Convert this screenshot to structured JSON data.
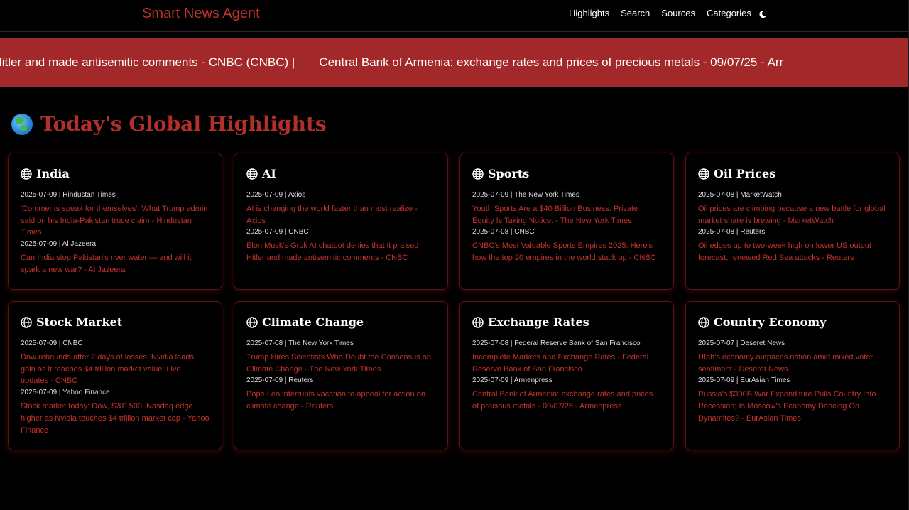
{
  "navbar": {
    "brand": "Smart News Agent",
    "links": [
      "Highlights",
      "Search",
      "Sources",
      "Categories"
    ],
    "theme_icon": "moon-icon"
  },
  "ticker": {
    "items": [
      "ot denies that it praised Hitler and made antisemitic comments - CNBC (CNBC) |",
      "Central Bank of Armenia: exchange rates and prices of precious metals - 09/07/25 - Arr"
    ]
  },
  "section": {
    "emoji": "globe-emoji-icon",
    "title": "Today's Global Highlights"
  },
  "colors": {
    "accent": "#b2302b",
    "ticker_bg": "#a3282a",
    "background": "#000000"
  },
  "cards": [
    {
      "title": "India",
      "articles": [
        {
          "meta": "2025-07-09 | Hindustan Times",
          "headline": "'Comments speak for themselves': What Trump admin said on his India-Pakistan truce claim - Hindustan Times"
        },
        {
          "meta": "2025-07-09 | Al Jazeera",
          "headline": "Can India stop Pakistan's river water — and will it spark a new war? - Al Jazeera"
        }
      ]
    },
    {
      "title": "AI",
      "articles": [
        {
          "meta": "2025-07-09 | Axios",
          "headline": "AI is changing the world faster than most realize - Axios"
        },
        {
          "meta": "2025-07-09 | CNBC",
          "headline": "Elon Musk's Grok AI chatbot denies that it praised Hitler and made antisemitic comments - CNBC"
        }
      ]
    },
    {
      "title": "Sports",
      "articles": [
        {
          "meta": "2025-07-09 | The New York Times",
          "headline": "Youth Sports Are a $40 Billion Business. Private Equity Is Taking Notice. - The New York Times"
        },
        {
          "meta": "2025-07-08 | CNBC",
          "headline": "CNBC's Most Valuable Sports Empires 2025: Here's how the top 20 empires in the world stack up - CNBC"
        }
      ]
    },
    {
      "title": "Oil Prices",
      "articles": [
        {
          "meta": "2025-07-08 | MarketWatch",
          "headline": "Oil prices are climbing because a new battle for global market share is brewing - MarketWatch"
        },
        {
          "meta": "2025-07-08 | Reuters",
          "headline": "Oil edges up to two-week high on lower US output forecast, renewed Red Sea attacks - Reuters"
        }
      ]
    },
    {
      "title": "Stock Market",
      "articles": [
        {
          "meta": "2025-07-09 | CNBC",
          "headline": "Dow rebounds after 2 days of losses, Nvidia leads gain as it reaches $4 trillion market value: Live updates - CNBC"
        },
        {
          "meta": "2025-07-09 | Yahoo Finance",
          "headline": "Stock market today: Dow, S&P 500, Nasdaq edge higher as Nvidia touches $4 trillion market cap - Yahoo Finance"
        }
      ]
    },
    {
      "title": "Climate Change",
      "articles": [
        {
          "meta": "2025-07-08 | The New York Times",
          "headline": "Trump Hires Scientists Who Doubt the Consensus on Climate Change - The New York Times"
        },
        {
          "meta": "2025-07-09 | Reuters",
          "headline": "Pope Leo interrupts vacation to appeal for action on climate change - Reuters"
        }
      ]
    },
    {
      "title": "Exchange Rates",
      "articles": [
        {
          "meta": "2025-07-08 | Federal Reserve Bank of San Francisco",
          "headline": "Incomplete Markets and Exchange Rates - Federal Reserve Bank of San Francisco"
        },
        {
          "meta": "2025-07-09 | Armenpress",
          "headline": "Central Bank of Armenia: exchange rates and prices of precious metals - 09/07/25 - Armenpress"
        }
      ]
    },
    {
      "title": "Country Economy",
      "articles": [
        {
          "meta": "2025-07-07 | Deseret News",
          "headline": "Utah's economy outpaces nation amid mixed voter sentiment - Deseret News"
        },
        {
          "meta": "2025-07-09 | EurAsian Times",
          "headline": "Russia's $300B War Expenditure Pulls Country Into Recession; Is Moscow's Economy Dancing On Dynamites? - EurAsian Times"
        }
      ]
    }
  ]
}
